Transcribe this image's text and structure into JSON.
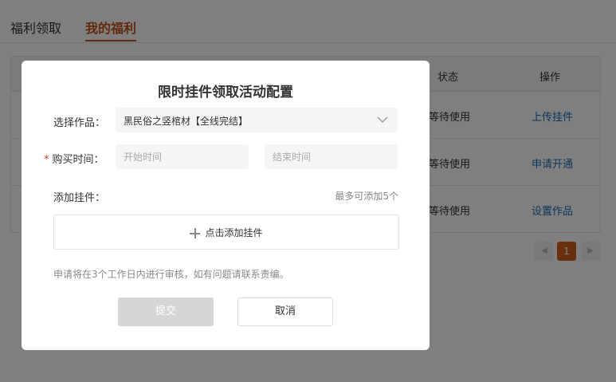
{
  "tabs": [
    {
      "label": "福利领取"
    },
    {
      "label": "我的福利"
    }
  ],
  "table": {
    "headers": {
      "status": "状态",
      "op": "操作"
    },
    "rows": [
      {
        "status": "等待使用",
        "op": "上传挂件"
      },
      {
        "status": "等待使用",
        "op": "申请开通"
      },
      {
        "status": "等待使用",
        "op": "设置作品"
      }
    ]
  },
  "pager": {
    "current": "1",
    "prev": "◀",
    "next": "▶"
  },
  "modal": {
    "title": "限时挂件领取活动配置",
    "work_label": "选择作品：",
    "work_value": "黑民俗之竖棺材【全线完结】",
    "time_required": "*",
    "time_label": "购买时间：",
    "start_placeholder": "开始时间",
    "end_placeholder": "结束时间",
    "pendant_label": "添加挂件：",
    "max_note": "最多可添加5个",
    "add_label": "点击添加挂件",
    "help": "申请将在3个工作日内进行审核，如有问题请联系责编。",
    "submit": "提交",
    "cancel": "取消"
  },
  "colors": {
    "accent": "#c4521a",
    "link": "#1a6fb5",
    "required": "#e0402a",
    "page_current": "#d1611f",
    "submit_disabled": "#d6d6d6"
  },
  "icons": [
    "chevron-down-icon",
    "plus-icon",
    "chevron-left-icon",
    "chevron-right-icon"
  ]
}
